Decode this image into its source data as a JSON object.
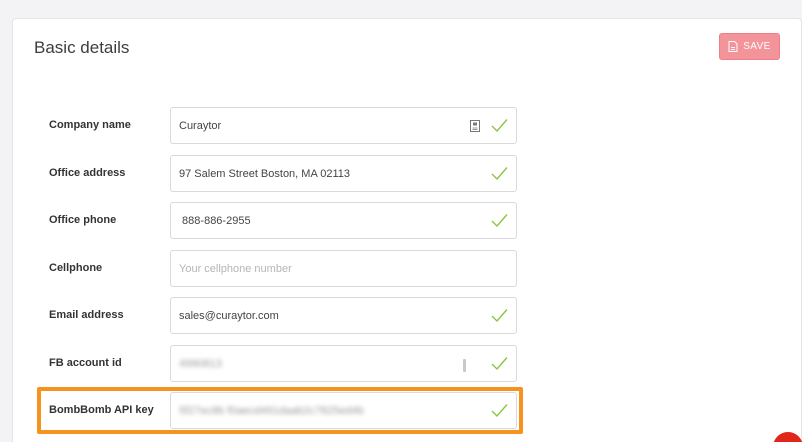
{
  "panel": {
    "title": "Basic details",
    "save_label": "SAVE"
  },
  "colors": {
    "save_bg": "#f2949a",
    "check": "#8cc63f",
    "highlight": "#f6921e",
    "badge": "#e0261a"
  },
  "icons": {
    "save": "save-file-icon",
    "valid": "checkmark-icon",
    "contact": "contact-card-icon"
  },
  "fields": [
    {
      "label": "Company name",
      "value": "Curaytor",
      "placeholder": "",
      "valid": true
    },
    {
      "label": "Office address",
      "value": "97 Salem Street Boston, MA 02113",
      "placeholder": "",
      "valid": true
    },
    {
      "label": "Office phone",
      "value": " 888-886-2955",
      "placeholder": "",
      "valid": true
    },
    {
      "label": "Cellphone",
      "value": "",
      "placeholder": "Your cellphone number",
      "valid": false
    },
    {
      "label": "Email address",
      "value": "sales@curaytor.com",
      "placeholder": "",
      "valid": true
    },
    {
      "label": "FB account id",
      "value": "4990813",
      "placeholder": "",
      "valid": true
    },
    {
      "label": "BombBomb API key",
      "value": "5f27ec8b f0aecd491daab2c7825ed4b",
      "placeholder": "",
      "valid": true
    }
  ]
}
